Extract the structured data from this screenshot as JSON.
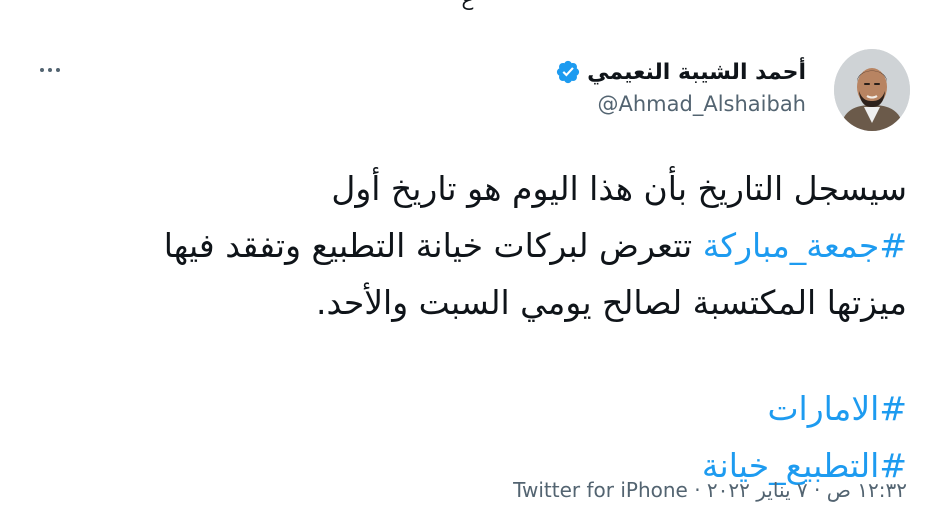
{
  "top_fragment": "ع",
  "author": {
    "display_name": "أحمد الشيبة النعيمي",
    "handle": "@Ahmad_Alshaibah",
    "verified": true
  },
  "more_icon": "more-horizontal-icon",
  "tweet": {
    "line1": "سيسجل التاريخ بأن هذا اليوم هو تاريخ أول",
    "line2_hashtag": "#جمعة_مباركة",
    "line2_text": " تتعرض لبركات خيانة التطبيع وتفقد فيها",
    "line3": "ميزتها المكتسبة لصالح يومي السبت والأحد.",
    "hashtag1": "#الامارات",
    "hashtag2": "#التطبيع_خيانة"
  },
  "meta": {
    "time": "١٢:٣٢ ص",
    "separator1": " · ",
    "date": "٧ يناير ٢٠٢٢",
    "separator2": " · ",
    "source": "Twitter for iPhone"
  },
  "colors": {
    "text": "#0f1419",
    "secondary": "#536471",
    "link": "#1d9bf0",
    "verified": "#1d9bf0"
  }
}
